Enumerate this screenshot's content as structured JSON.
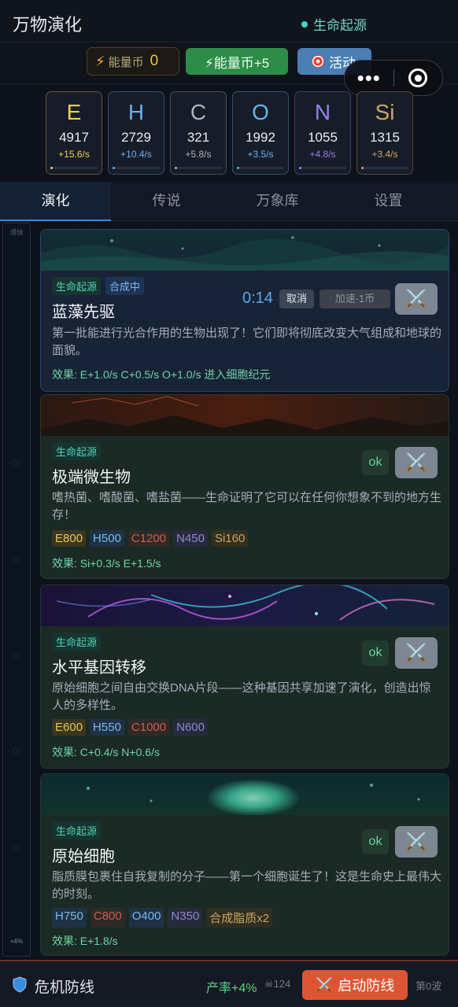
{
  "header": {
    "title": "万物演化",
    "era": "生命起源"
  },
  "toolbar": {
    "coin_label": "能量币",
    "coin_value": "0",
    "energy_plus_label": "⚡能量币+5",
    "event_label": "活动"
  },
  "miniprogram": {
    "more": "•••"
  },
  "elements": [
    {
      "symbol": "E",
      "amount": "4917",
      "rate": "+15.6/s",
      "color": "#f0cd52",
      "fill": 0.05
    },
    {
      "symbol": "H",
      "amount": "2729",
      "rate": "+10.4/s",
      "color": "#69b2ef",
      "fill": 0.05
    },
    {
      "symbol": "C",
      "amount": "321",
      "rate": "+5.8/s",
      "color": "#aeb5bf",
      "fill": 0.05
    },
    {
      "symbol": "O",
      "amount": "1992",
      "rate": "+3.5/s",
      "color": "#63b4f2",
      "fill": 0.05
    },
    {
      "symbol": "N",
      "amount": "1055",
      "rate": "+4.8/s",
      "color": "#9b7ff0",
      "fill": 0.05
    },
    {
      "symbol": "Si",
      "amount": "1315",
      "rate": "+3.4/s",
      "color": "#d1a55c",
      "fill": 0.05
    }
  ],
  "tabs": [
    "演化",
    "传说",
    "万象库",
    "设置"
  ],
  "rail": {
    "top_label": "侵蚀",
    "bottom_label": "+4%"
  },
  "cards": [
    {
      "tag": "生命起源",
      "status_tag": "合成中",
      "title": "蓝藻先驱",
      "timer": "0:14",
      "cancel": "取消",
      "speedup": "加速-1币",
      "desc": "第一批能进行光合作用的生物出现了！它们即将彻底改变大气组成和地球的面貌。",
      "effect": "效果: E+1.0/s  C+0.5/s  O+1.0/s  进入细胞纪元"
    },
    {
      "tag": "生命起源",
      "title": "极端微生物",
      "ok": "ok",
      "desc": "嗜热菌、嗜酸菌、嗜盐菌——生命证明了它可以在任何你想象不到的地方生存！",
      "costs": [
        "E800",
        "H500",
        "C1200",
        "N450",
        "Si160"
      ],
      "effect": "效果: Si+0.3/s  E+1.5/s"
    },
    {
      "tag": "生命起源",
      "title": "水平基因转移",
      "ok": "ok",
      "desc": "原始细胞之间自由交换DNA片段——这种基因共享加速了演化，创造出惊人的多样性。",
      "costs": [
        "E600",
        "H550",
        "C1000",
        "N600"
      ],
      "effect": "效果: C+0.4/s  N+0.6/s"
    },
    {
      "tag": "生命起源",
      "title": "原始细胞",
      "ok": "ok",
      "desc": "脂质膜包裹住自我复制的分子——第一个细胞诞生了！这是生命史上最伟大的时刻。",
      "costs": [
        "H750",
        "C800",
        "O400",
        "N350",
        "合成脂质x2"
      ],
      "effect": "效果: E+1.8/s"
    }
  ],
  "bottom": {
    "crisis": "危机防线",
    "production": "产率+4%",
    "enemies": "124",
    "launch": "启动防线",
    "wave": "第0波"
  }
}
